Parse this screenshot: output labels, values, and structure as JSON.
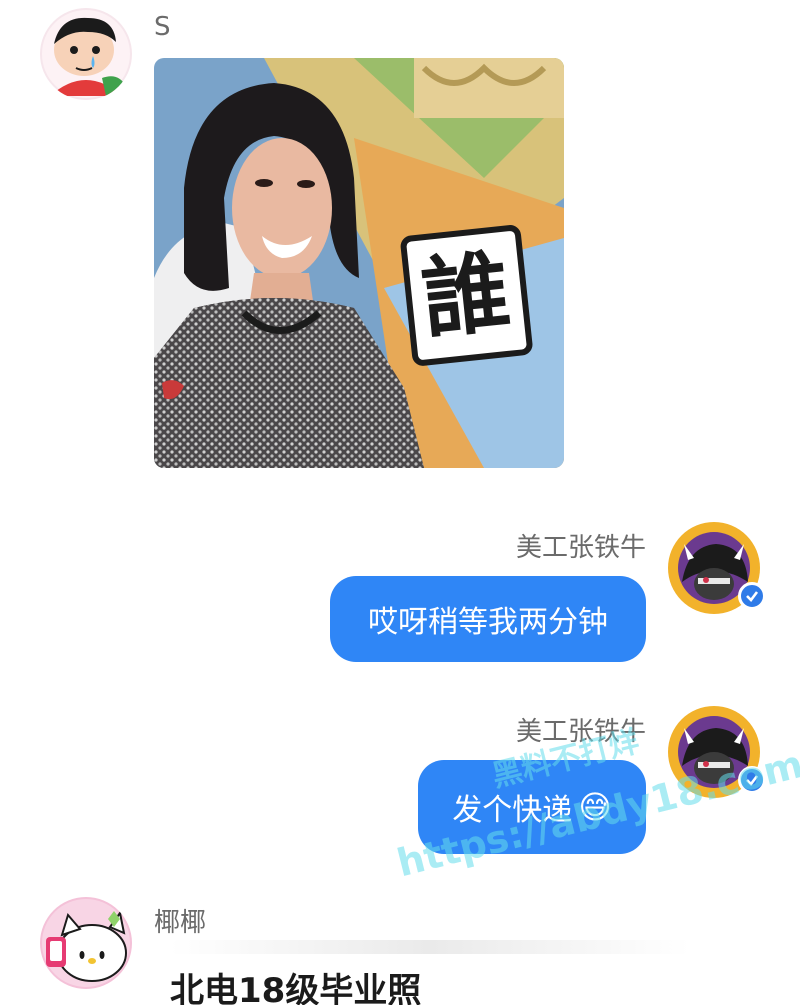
{
  "messages": [
    {
      "sender": "S",
      "type": "image",
      "avatar_icon": "cartoon-boy-crying-avatar",
      "image_caption": "誰"
    },
    {
      "sender": "美工张铁牛",
      "type": "text",
      "text": "哎呀稍等我两分钟",
      "avatar_icon": "goat-character-avatar",
      "verified_icon": "verified-check-icon"
    },
    {
      "sender": "美工张铁牛",
      "type": "text",
      "text": "发个快递",
      "emoji": "😅",
      "avatar_icon": "goat-character-avatar",
      "verified_icon": "verified-check-icon"
    },
    {
      "sender": "椰椰",
      "type": "text",
      "text": "北电18级毕业照",
      "avatar_icon": "hello-kitty-avatar"
    }
  ],
  "watermark": {
    "line1": "黑料不打烊",
    "line2": "https://abdy18.com"
  },
  "colors": {
    "bubble_blue": "#2f86f6",
    "verified_blue": "#2f7be8",
    "name_gray": "#6b6b6b",
    "background": "#ffffff"
  }
}
